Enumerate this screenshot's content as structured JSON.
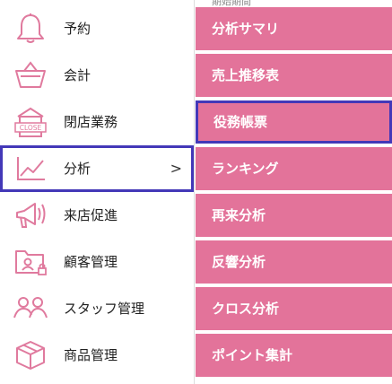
{
  "top_strip_text": "期始期間",
  "left_menu": {
    "items": [
      {
        "label": "予約",
        "icon": "bell-icon"
      },
      {
        "label": "会計",
        "icon": "basket-icon"
      },
      {
        "label": "閉店業務",
        "icon": "close-shop-icon",
        "icon_text": "CLOSE"
      },
      {
        "label": "分析",
        "icon": "chart-icon",
        "chevron": ">"
      },
      {
        "label": "来店促進",
        "icon": "megaphone-icon"
      },
      {
        "label": "顧客管理",
        "icon": "customer-folder-icon"
      },
      {
        "label": "スタッフ管理",
        "icon": "staff-icon"
      },
      {
        "label": "商品管理",
        "icon": "product-box-icon"
      }
    ]
  },
  "submenu": {
    "items": [
      {
        "label": "分析サマリ"
      },
      {
        "label": "売上推移表"
      },
      {
        "label": "役務帳票"
      },
      {
        "label": "ランキング"
      },
      {
        "label": "再来分析"
      },
      {
        "label": "反響分析"
      },
      {
        "label": "クロス分析"
      },
      {
        "label": "ポイント集計"
      }
    ]
  },
  "colors": {
    "accent_pink": "#e3739a",
    "selection_border": "#4338b8",
    "icon_pink": "#e07a9e"
  }
}
